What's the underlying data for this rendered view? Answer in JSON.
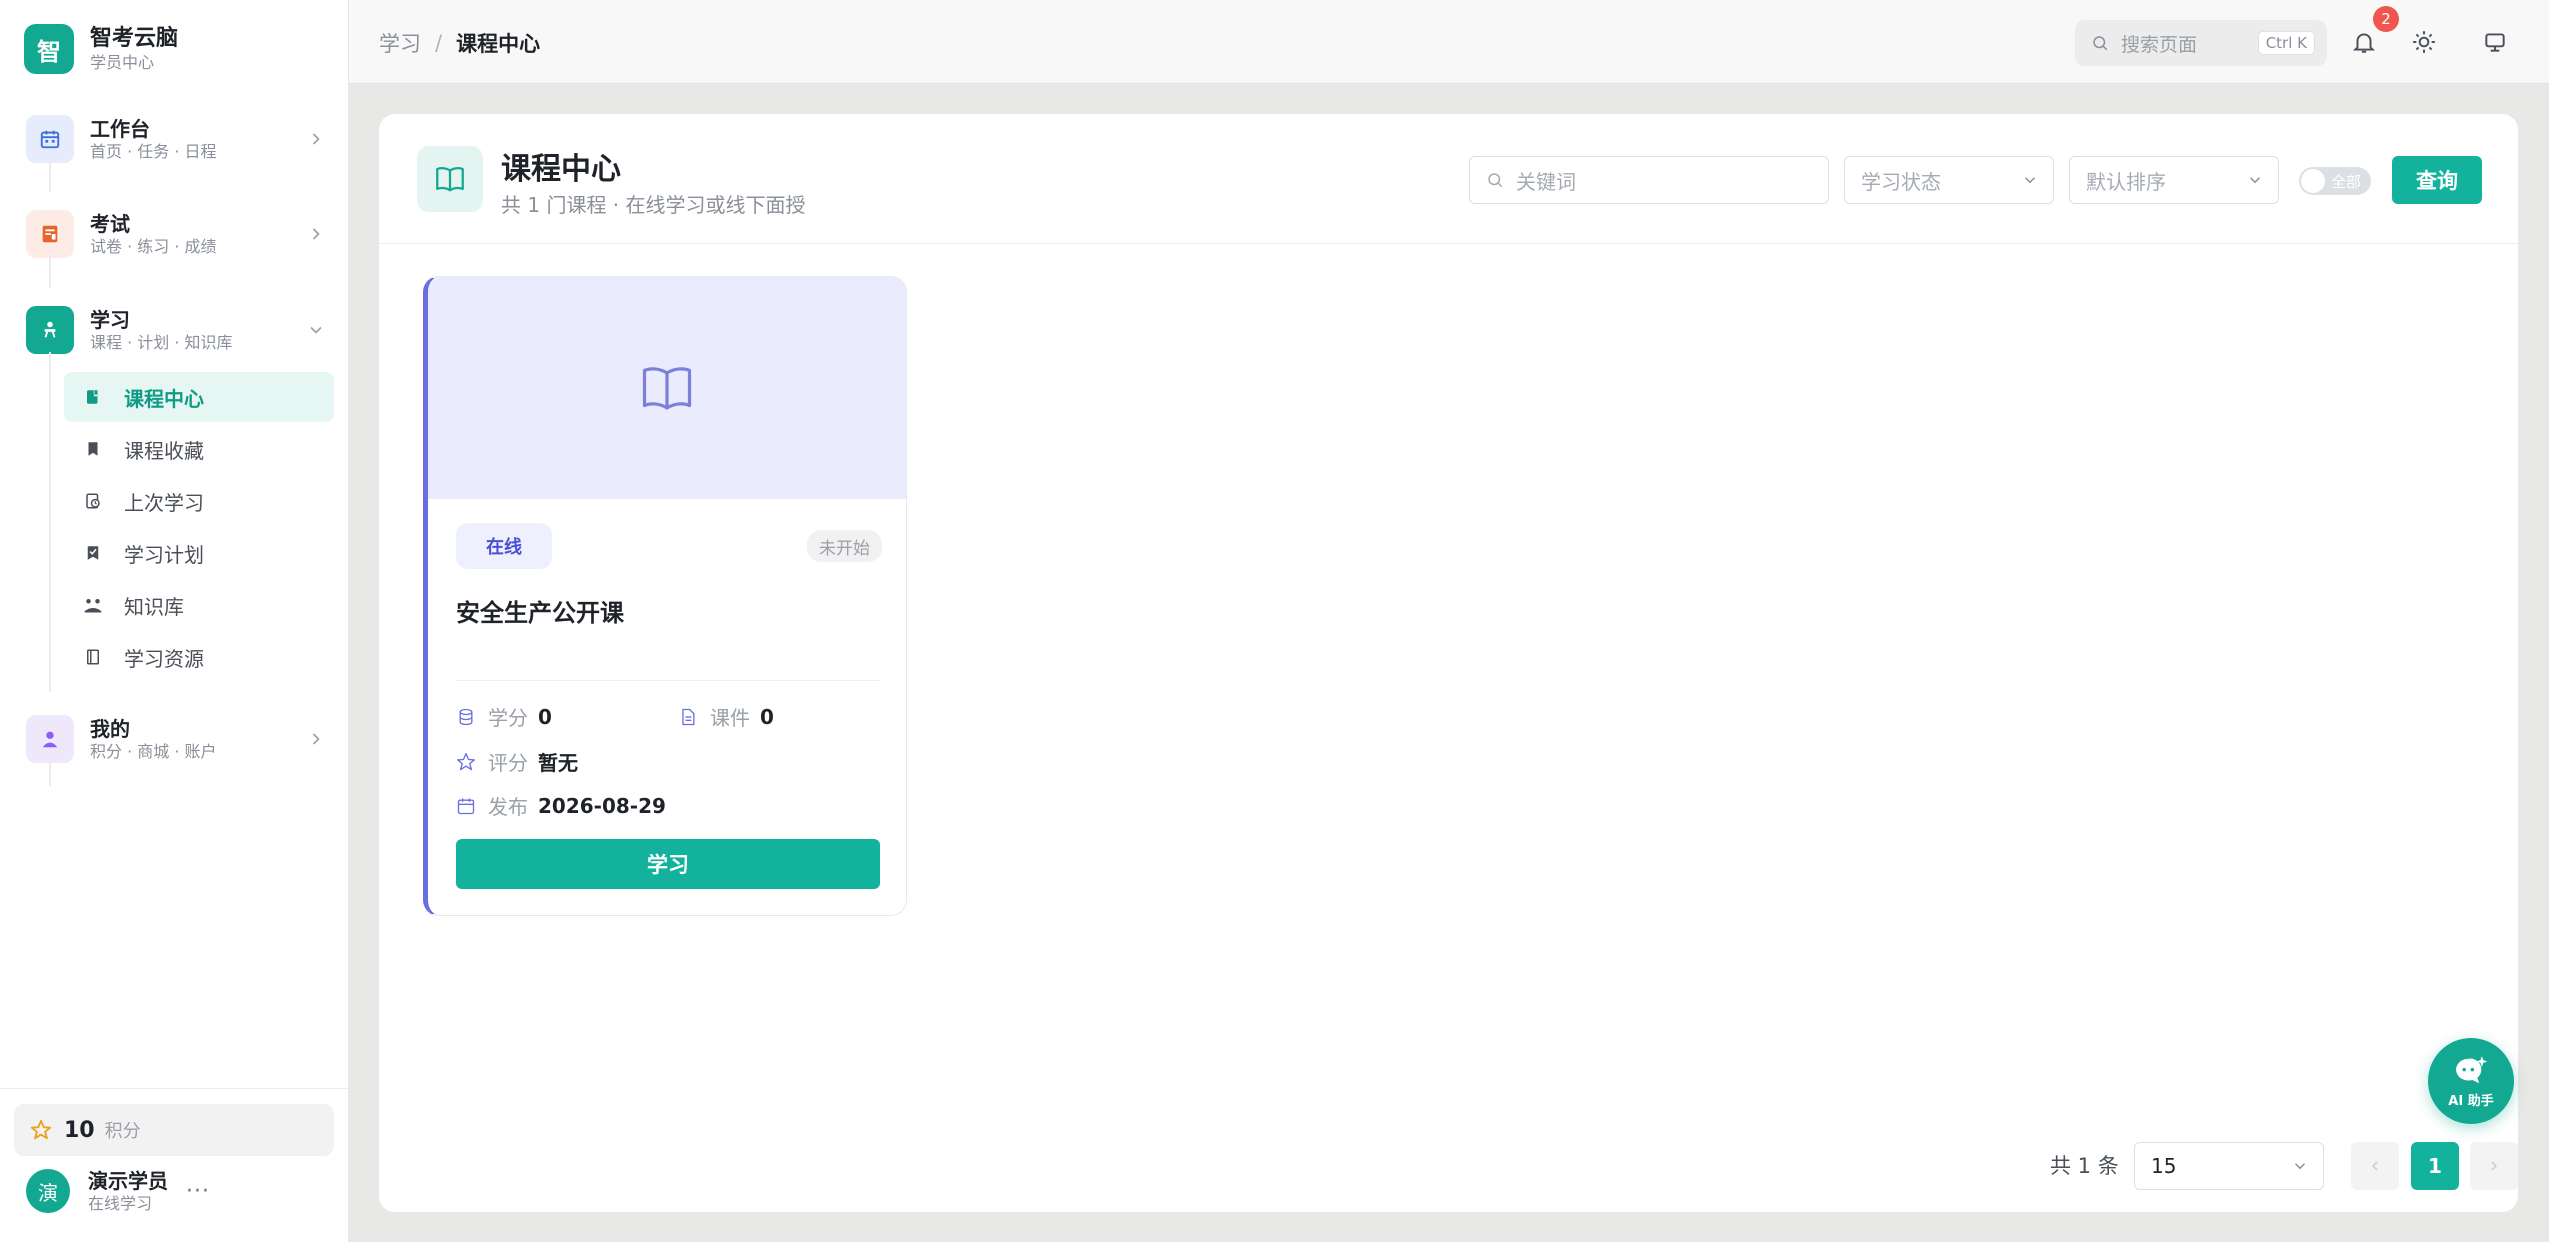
{
  "brand": {
    "logo_char": "智",
    "name": "智考云脑",
    "subtitle": "学员中心"
  },
  "nav": {
    "workspace": {
      "title": "工作台",
      "subtitle": "首页 · 任务 · 日程"
    },
    "exam": {
      "title": "考试",
      "subtitle": "试卷 · 练习 · 成绩"
    },
    "study": {
      "title": "学习",
      "subtitle": "课程 · 计划 · 知识库",
      "items": [
        {
          "label": "课程中心"
        },
        {
          "label": "课程收藏"
        },
        {
          "label": "上次学习"
        },
        {
          "label": "学习计划"
        },
        {
          "label": "知识库"
        },
        {
          "label": "学习资源"
        }
      ]
    },
    "mine": {
      "title": "我的",
      "subtitle": "积分 · 商城 · 账户"
    }
  },
  "points": {
    "value": "10",
    "label": "积分"
  },
  "user": {
    "avatar_char": "演",
    "name": "演示学员",
    "status": "在线学习",
    "more": "···"
  },
  "topbar": {
    "breadcrumb_parent": "学习",
    "breadcrumb_sep": "/",
    "breadcrumb_current": "课程中心",
    "search_placeholder": "搜索页面",
    "search_shortcut": "Ctrl K",
    "notification_count": "2"
  },
  "page": {
    "title": "课程中心",
    "subtitle": "共 1 门课程 · 在线学习或线下面授",
    "keyword_placeholder": "关键词",
    "status_select": "学习状态",
    "sort_select": "默认排序",
    "toggle_label": "全部",
    "query_button": "查询"
  },
  "course": {
    "mode_tag": "在线",
    "status_tag": "未开始",
    "name": "安全生产公开课",
    "credit_label": "学分",
    "credit_value": "0",
    "courseware_label": "课件",
    "courseware_value": "0",
    "rating_label": "评分",
    "rating_value": "暂无",
    "publish_label": "发布",
    "publish_value": "2026-08-29",
    "study_button": "学习"
  },
  "pagination": {
    "total": "共 1 条",
    "page_size": "15",
    "current_page": "1"
  },
  "ai_assistant": {
    "label": "AI 助手"
  },
  "colors": {
    "accent": "#13b29c",
    "brand": "#13a892",
    "indigo": "#6a6fe0",
    "badge": "#f0554f"
  }
}
